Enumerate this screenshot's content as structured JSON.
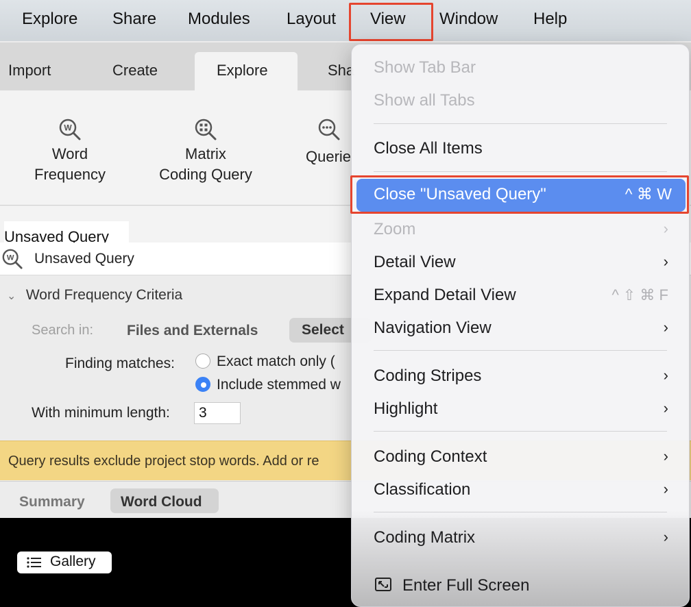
{
  "menubar": {
    "items": [
      "Explore",
      "Share",
      "Modules",
      "Layout",
      "View",
      "Window",
      "Help"
    ]
  },
  "ribbon": {
    "tabs": [
      "Import",
      "Create",
      "Explore",
      "Sha"
    ],
    "active_tab": "Explore",
    "buttons": [
      {
        "line1": "Word",
        "line2": "Frequency",
        "icon": "word-frequency-icon"
      },
      {
        "line1": "Matrix",
        "line2": "Coding Query",
        "icon": "matrix-query-icon"
      },
      {
        "line1": "Querie",
        "line2": "",
        "icon": "queries-icon"
      }
    ]
  },
  "query": {
    "title": "Unsaved Query",
    "name": "Unsaved Query"
  },
  "criteria": {
    "heading": "Word Frequency Criteria",
    "search_in_label": "Search in:",
    "search_in_value": "Files and Externals",
    "select_button": "Select",
    "finding_label": "Finding matches:",
    "options": [
      {
        "label": "Exact match only (",
        "selected": false
      },
      {
        "label": "Include stemmed w",
        "selected": true
      }
    ],
    "min_length_label": "With minimum length:",
    "min_length_value": "3"
  },
  "banner": {
    "text": "Query results exclude project stop words. Add or re"
  },
  "results_tabs": {
    "summary": "Summary",
    "word_cloud": "Word Cloud",
    "active": "Word Cloud"
  },
  "preview": {
    "gallery_button": "Gallery"
  },
  "view_menu": {
    "show_tab_bar": "Show Tab Bar",
    "show_all_tabs": "Show all Tabs",
    "close_all_items": "Close All Items",
    "close_unsaved": "Close \"Unsaved Query\"",
    "close_unsaved_shortcut": "^ ⌘ W",
    "zoom": "Zoom",
    "detail_view": "Detail View",
    "expand_detail_view": "Expand Detail View",
    "expand_detail_shortcut": "^ ⇧ ⌘ F",
    "navigation_view": "Navigation View",
    "coding_stripes": "Coding Stripes",
    "highlight": "Highlight",
    "coding_context": "Coding Context",
    "classification": "Classification",
    "coding_matrix": "Coding Matrix",
    "enter_full_screen": "Enter Full Screen"
  },
  "colors": {
    "highlight": "#5b8def",
    "annotation_box": "#e5452f",
    "banner": "#f3d684",
    "radio_selected": "#3b82f6"
  }
}
